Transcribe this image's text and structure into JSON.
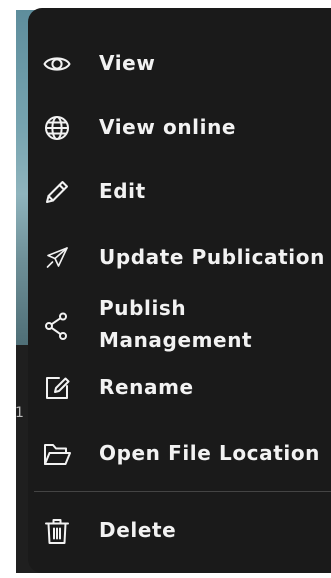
{
  "background": {
    "partial_number": "1"
  },
  "menu": {
    "items": [
      {
        "id": "view",
        "label": "View",
        "icon": "eye-icon"
      },
      {
        "id": "view-online",
        "label": "View online",
        "icon": "globe-icon"
      },
      {
        "id": "edit",
        "label": "Edit",
        "icon": "pencil-icon"
      },
      {
        "id": "update-publication",
        "label": "Update Publication",
        "icon": "send-icon"
      },
      {
        "id": "publish-management",
        "label_line1": "Publish",
        "label_line2": "Management",
        "icon": "share-icon"
      },
      {
        "id": "rename",
        "label": "Rename",
        "icon": "rename-icon"
      },
      {
        "id": "open-file-location",
        "label": "Open File Location",
        "icon": "folder-icon"
      },
      {
        "id": "delete",
        "label": "Delete",
        "icon": "trash-icon"
      }
    ]
  },
  "colors": {
    "menu_background": "#1a1a1a",
    "text": "#f2f2f2",
    "divider": "#444444"
  }
}
